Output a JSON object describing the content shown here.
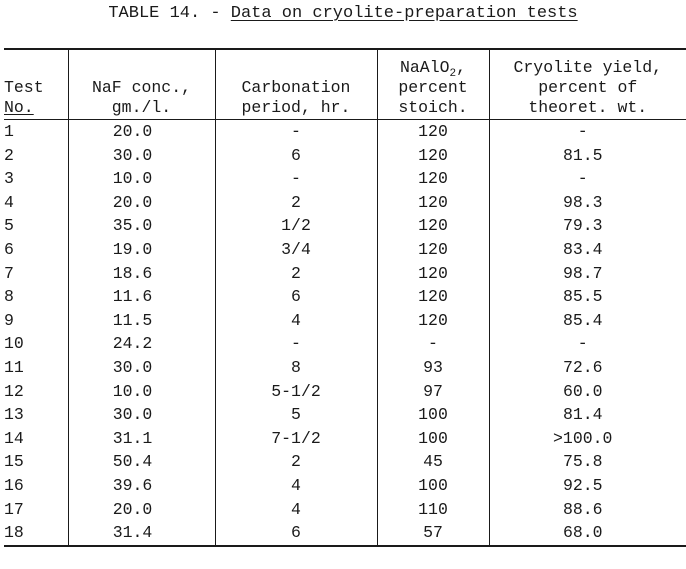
{
  "title": {
    "label": "TABLE 14. - ",
    "caption": "Data on cryolite-preparation tests"
  },
  "table": {
    "headers": {
      "test": [
        "Test",
        "No."
      ],
      "naf": [
        "NaF conc.,",
        "gm./l."
      ],
      "carbonation": [
        "Carbonation",
        "period, hr."
      ],
      "naalo2": [
        "NaAlO",
        "2",
        ",",
        "percent",
        "stoich."
      ],
      "yield": [
        "Cryolite yield,",
        "percent of",
        "theoret. wt."
      ]
    },
    "rows": [
      {
        "test": "1",
        "naf": "20.0",
        "carbonation": "-",
        "naalo2": "120",
        "yield": "-"
      },
      {
        "test": "2",
        "naf": "30.0",
        "carbonation": "6",
        "naalo2": "120",
        "yield": "81.5"
      },
      {
        "test": "3",
        "naf": "10.0",
        "carbonation": "-",
        "naalo2": "120",
        "yield": "-"
      },
      {
        "test": "4",
        "naf": "20.0",
        "carbonation": "2",
        "naalo2": "120",
        "yield": "98.3"
      },
      {
        "test": "5",
        "naf": "35.0",
        "carbonation": "1/2",
        "naalo2": "120",
        "yield": "79.3"
      },
      {
        "test": "6",
        "naf": "19.0",
        "carbonation": "3/4",
        "naalo2": "120",
        "yield": "83.4"
      },
      {
        "test": "7",
        "naf": "18.6",
        "carbonation": "2",
        "naalo2": "120",
        "yield": "98.7"
      },
      {
        "test": "8",
        "naf": "11.6",
        "carbonation": "6",
        "naalo2": "120",
        "yield": "85.5"
      },
      {
        "test": "9",
        "naf": "11.5",
        "carbonation": "4",
        "naalo2": "120",
        "yield": "85.4"
      },
      {
        "test": "10",
        "naf": "24.2",
        "carbonation": "-",
        "naalo2": "-",
        "yield": "-"
      },
      {
        "test": "11",
        "naf": "30.0",
        "carbonation": "8",
        "naalo2": "93",
        "yield": "72.6"
      },
      {
        "test": "12",
        "naf": "10.0",
        "carbonation": "5-1/2",
        "naalo2": "97",
        "yield": "60.0"
      },
      {
        "test": "13",
        "naf": "30.0",
        "carbonation": "5",
        "naalo2": "100",
        "yield": "81.4"
      },
      {
        "test": "14",
        "naf": "31.1",
        "carbonation": "7-1/2",
        "naalo2": "100",
        "yield": ">100.0"
      },
      {
        "test": "15",
        "naf": "50.4",
        "carbonation": "2",
        "naalo2": "45",
        "yield": "75.8"
      },
      {
        "test": "16",
        "naf": "39.6",
        "carbonation": "4",
        "naalo2": "100",
        "yield": "92.5"
      },
      {
        "test": "17",
        "naf": "20.0",
        "carbonation": "4",
        "naalo2": "110",
        "yield": "88.6"
      },
      {
        "test": "18",
        "naf": "31.4",
        "carbonation": "6",
        "naalo2": "57",
        "yield": "68.0"
      }
    ]
  }
}
